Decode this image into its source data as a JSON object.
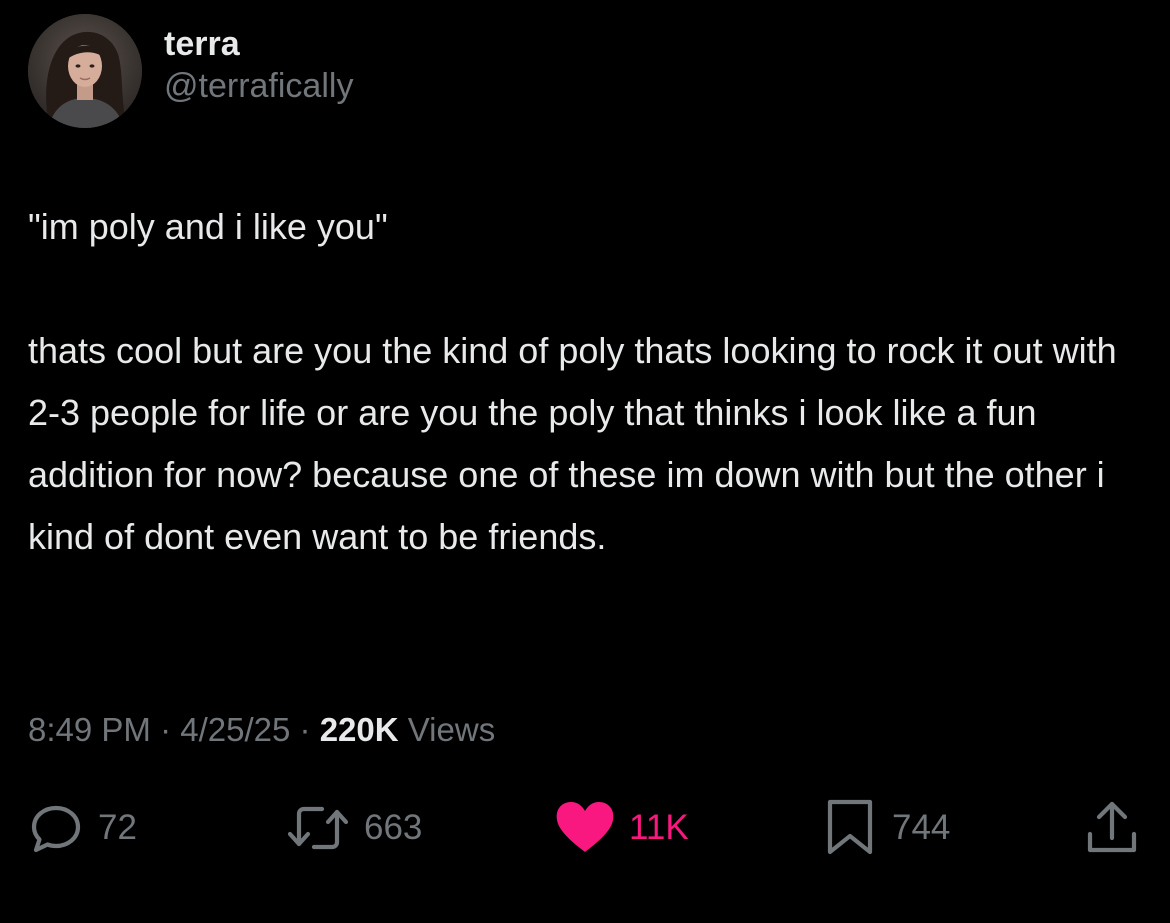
{
  "author": {
    "display_name": "terra",
    "handle": "@terrafically",
    "avatar_icon": "profile-photo"
  },
  "tweet": {
    "paragraphs": [
      "\"im poly and i like you\"",
      "thats cool but are you the kind of poly thats looking to rock it out with 2-3 people for life or are you the poly that thinks i look like a fun addition for now? because one of these im down with but the other i kind of dont even want to be friends."
    ]
  },
  "meta": {
    "time": "8:49 PM",
    "separator": "·",
    "date": "4/25/25",
    "views_count": "220K",
    "views_label": "Views"
  },
  "actions": {
    "reply": {
      "icon": "reply-icon",
      "count": "72"
    },
    "retweet": {
      "icon": "retweet-icon",
      "count": "663"
    },
    "like": {
      "icon": "heart-icon",
      "count": "11K",
      "liked": true
    },
    "bookmark": {
      "icon": "bookmark-icon",
      "count": "744"
    },
    "share": {
      "icon": "share-icon"
    }
  },
  "colors": {
    "background": "#000000",
    "text_primary": "#e7e9ea",
    "text_secondary": "#71767b",
    "like_active": "#f91880"
  }
}
